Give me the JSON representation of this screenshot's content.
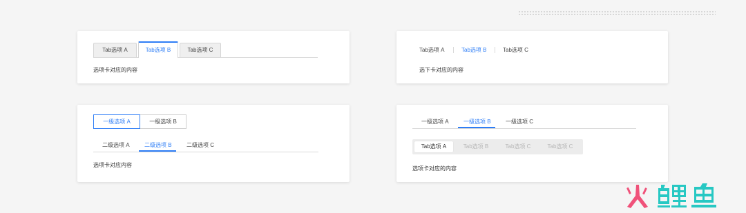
{
  "colors": {
    "accent": "#2d7df6",
    "watermark_pink": "#f0527a",
    "watermark_teal": "#27c8c3"
  },
  "card1": {
    "tabs": [
      {
        "label": "Tab选项 A",
        "active": false
      },
      {
        "label": "Tab选项 B",
        "active": true
      },
      {
        "label": "Tab选项 C",
        "active": false
      }
    ],
    "content": "选项卡对应的内容"
  },
  "card2": {
    "tabs": [
      {
        "label": "Tab选项 A",
        "active": false
      },
      {
        "label": "Tab选项 B",
        "active": true
      },
      {
        "label": "Tab选项 C",
        "active": false
      }
    ],
    "content": "选下卡对应的内容"
  },
  "card3": {
    "level1": [
      {
        "label": "一级选项 A",
        "active": true
      },
      {
        "label": "一级选项 B",
        "active": false
      }
    ],
    "level2": [
      {
        "label": "二级选项 A",
        "active": false
      },
      {
        "label": "二级选项 B",
        "active": true
      },
      {
        "label": "二级选项 C",
        "active": false
      }
    ],
    "content": "选项卡对应内容"
  },
  "card4": {
    "level1": [
      {
        "label": "一级选项 A",
        "active": false
      },
      {
        "label": "一级选项 B",
        "active": true
      },
      {
        "label": "一级选项 C",
        "active": false
      }
    ],
    "tabs": [
      {
        "label": "Tab选项 A",
        "active": true
      },
      {
        "label": "Tab选项 B",
        "active": false
      },
      {
        "label": "Tab选项 C",
        "active": false
      },
      {
        "label": "Tab选项 C",
        "active": false
      }
    ],
    "content": "选项卡对应的内容"
  },
  "watermark": {
    "text": "火鲤鱼"
  }
}
